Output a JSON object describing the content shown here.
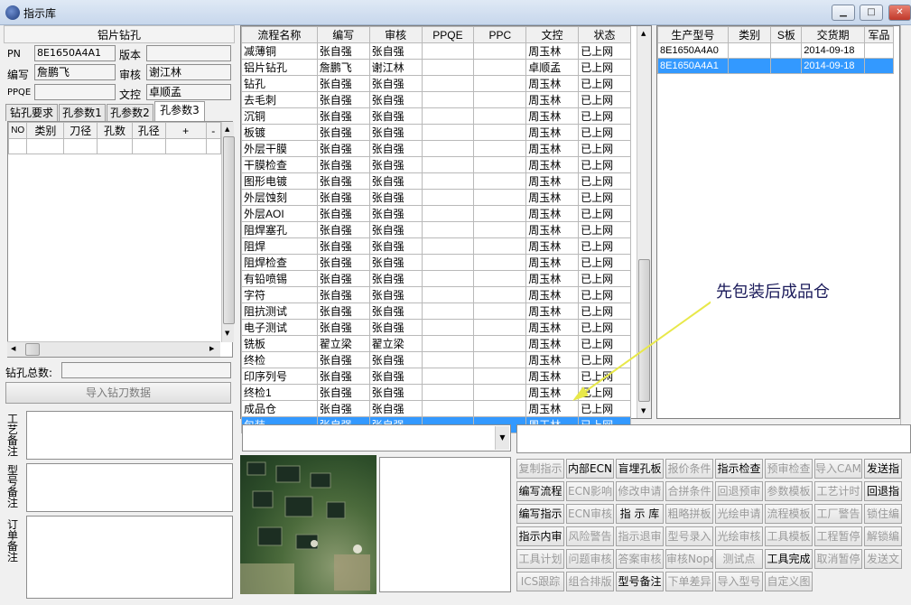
{
  "window": {
    "title": "指示库"
  },
  "left": {
    "header": "铝片钻孔",
    "pn_label": "PN",
    "pn_value": "8E1650A4A1",
    "version_label": "版本",
    "version_value": "",
    "author_label": "编写",
    "author_value": "詹鹏飞",
    "reviewer_label": "审核",
    "reviewer_value": "谢江林",
    "ppqe_label": "PPQE",
    "ppqe_value": "",
    "control_label": "文控",
    "control_value": "卓顺孟",
    "tabs": [
      "钻孔要求",
      "孔参数1",
      "孔参数2",
      "孔参数3"
    ],
    "grid_headers": [
      "NO",
      "类别",
      "刀径",
      "孔数",
      "孔径",
      "+",
      "-"
    ],
    "total_label": "钻孔总数:",
    "total_value": "",
    "import_button": "导入钻刀数据",
    "notes": [
      "工艺备注",
      "型号备注",
      "订单备注"
    ]
  },
  "process_table": {
    "headers": [
      "流程名称",
      "编写",
      "审核",
      "PPQE",
      "PPC",
      "文控",
      "状态"
    ],
    "rows": [
      [
        "减薄铜",
        "张自强",
        "张自强",
        "",
        "",
        "周玉林",
        "已上网"
      ],
      [
        "铝片钻孔",
        "詹鹏飞",
        "谢江林",
        "",
        "",
        "卓顺孟",
        "已上网"
      ],
      [
        "钻孔",
        "张自强",
        "张自强",
        "",
        "",
        "周玉林",
        "已上网"
      ],
      [
        "去毛刺",
        "张自强",
        "张自强",
        "",
        "",
        "周玉林",
        "已上网"
      ],
      [
        "沉铜",
        "张自强",
        "张自强",
        "",
        "",
        "周玉林",
        "已上网"
      ],
      [
        "板镀",
        "张自强",
        "张自强",
        "",
        "",
        "周玉林",
        "已上网"
      ],
      [
        "外层干膜",
        "张自强",
        "张自强",
        "",
        "",
        "周玉林",
        "已上网"
      ],
      [
        "干膜检查",
        "张自强",
        "张自强",
        "",
        "",
        "周玉林",
        "已上网"
      ],
      [
        "图形电镀",
        "张自强",
        "张自强",
        "",
        "",
        "周玉林",
        "已上网"
      ],
      [
        "外层蚀刻",
        "张自强",
        "张自强",
        "",
        "",
        "周玉林",
        "已上网"
      ],
      [
        "外层AOI",
        "张自强",
        "张自强",
        "",
        "",
        "周玉林",
        "已上网"
      ],
      [
        "阻焊塞孔",
        "张自强",
        "张自强",
        "",
        "",
        "周玉林",
        "已上网"
      ],
      [
        "阻焊",
        "张自强",
        "张自强",
        "",
        "",
        "周玉林",
        "已上网"
      ],
      [
        "阻焊检查",
        "张自强",
        "张自强",
        "",
        "",
        "周玉林",
        "已上网"
      ],
      [
        "有铅喷锡",
        "张自强",
        "张自强",
        "",
        "",
        "周玉林",
        "已上网"
      ],
      [
        "字符",
        "张自强",
        "张自强",
        "",
        "",
        "周玉林",
        "已上网"
      ],
      [
        "阻抗测试",
        "张自强",
        "张自强",
        "",
        "",
        "周玉林",
        "已上网"
      ],
      [
        "电子测试",
        "张自强",
        "张自强",
        "",
        "",
        "周玉林",
        "已上网"
      ],
      [
        "铣板",
        "翟立梁",
        "翟立梁",
        "",
        "",
        "周玉林",
        "已上网"
      ],
      [
        "终检",
        "张自强",
        "张自强",
        "",
        "",
        "周玉林",
        "已上网"
      ],
      [
        "印序列号",
        "张自强",
        "张自强",
        "",
        "",
        "周玉林",
        "已上网"
      ],
      [
        "终检1",
        "张自强",
        "张自强",
        "",
        "",
        "周玉林",
        "已上网"
      ],
      [
        "成品仓",
        "张自强",
        "张自强",
        "",
        "",
        "周玉林",
        "已上网"
      ],
      [
        "包装",
        "张自强",
        "张自强",
        "",
        "",
        "周玉林",
        "已上网"
      ]
    ],
    "selected_index": 23
  },
  "production_table": {
    "headers": [
      "生产型号",
      "类别",
      "S板",
      "交货期",
      "军品"
    ],
    "rows": [
      [
        "8E1650A4A0",
        "",
        "",
        "2014-09-18",
        ""
      ],
      [
        "8E1650A4A1",
        "",
        "",
        "2014-09-18",
        ""
      ]
    ],
    "selected_index": 1
  },
  "callout": "先包装后成品仓",
  "buttons": [
    [
      {
        "label": "复制指示",
        "on": false
      },
      {
        "label": "内部ECN",
        "on": true
      },
      {
        "label": "盲埋孔板",
        "on": true
      },
      {
        "label": "报价条件",
        "on": false
      },
      {
        "label": "指示检查",
        "on": true
      },
      {
        "label": "预审检查",
        "on": false
      },
      {
        "label": "导入CAM",
        "on": false
      },
      {
        "label": "发送指",
        "on": true
      }
    ],
    [
      {
        "label": "编写流程",
        "on": true
      },
      {
        "label": "ECN影响",
        "on": false
      },
      {
        "label": "修改申请",
        "on": false
      },
      {
        "label": "合拼条件",
        "on": false
      },
      {
        "label": "回退预审",
        "on": false
      },
      {
        "label": "参数模板",
        "on": false
      },
      {
        "label": "工艺计时",
        "on": false
      },
      {
        "label": "回退指",
        "on": true
      }
    ],
    [
      {
        "label": "编写指示",
        "on": true
      },
      {
        "label": "ECN审核",
        "on": false
      },
      {
        "label": "指 示 库",
        "on": true
      },
      {
        "label": "粗略拼板",
        "on": false
      },
      {
        "label": "光绘申请",
        "on": false
      },
      {
        "label": "流程模板",
        "on": false
      },
      {
        "label": "工厂警告",
        "on": false
      },
      {
        "label": "锁住编",
        "on": false
      }
    ],
    [
      {
        "label": "指示内审",
        "on": true
      },
      {
        "label": "风险警告",
        "on": false
      },
      {
        "label": "指示退审",
        "on": false
      },
      {
        "label": "型号录入",
        "on": false
      },
      {
        "label": "光绘审核",
        "on": false
      },
      {
        "label": "工具模板",
        "on": false
      },
      {
        "label": "工程暂停",
        "on": false
      },
      {
        "label": "解锁编",
        "on": false
      }
    ],
    [
      {
        "label": "工具计划",
        "on": false
      },
      {
        "label": "问题审核",
        "on": false
      },
      {
        "label": "答案审核",
        "on": false
      },
      {
        "label": "审核Nope",
        "on": false
      },
      {
        "label": "测试点",
        "on": false
      },
      {
        "label": "工具完成",
        "on": true
      },
      {
        "label": "取消暂停",
        "on": false
      },
      {
        "label": "发送文",
        "on": false
      }
    ],
    [
      {
        "label": "ICS跟踪",
        "on": false
      },
      {
        "label": "组合排版",
        "on": false
      },
      {
        "label": "型号备注",
        "on": true
      },
      {
        "label": "下单差异",
        "on": false
      },
      {
        "label": "导入型号",
        "on": false
      },
      {
        "label": "自定义图",
        "on": false
      }
    ]
  ]
}
